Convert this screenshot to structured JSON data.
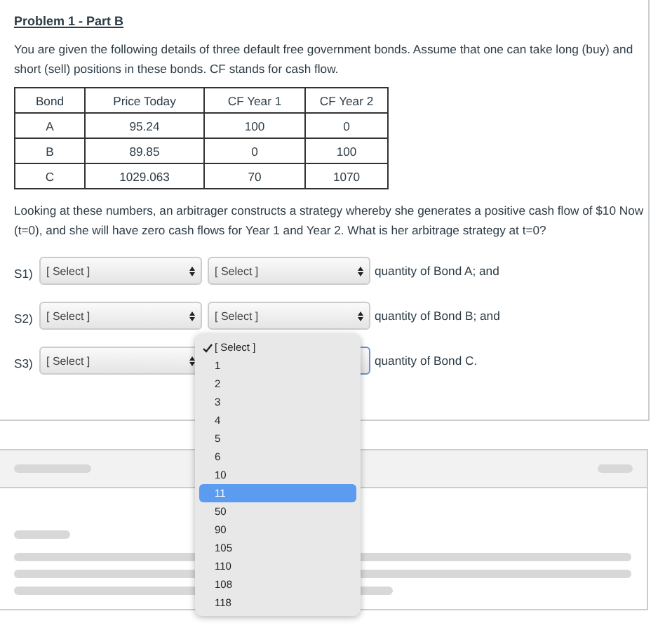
{
  "title": "Problem 1 - Part B",
  "intro": "You are given the following details of three default free government bonds. Assume that one can take long (buy) and short (sell) positions in these bonds. CF stands for cash flow.",
  "table": {
    "columns": [
      "Bond",
      "Price Today",
      "CF Year 1",
      "CF Year 2"
    ],
    "rows": [
      [
        "A",
        "95.24",
        "100",
        "0"
      ],
      [
        "B",
        "89.85",
        "0",
        "100"
      ],
      [
        "C",
        "1029.063",
        "70",
        "1070"
      ]
    ]
  },
  "question": "Looking at these numbers, an arbitrager constructs a strategy whereby she generates a positive cash flow of $10 Now (t=0), and she will have zero cash flows for Year 1 and Year 2. What is her arbitrage strategy at t=0?",
  "statements": [
    {
      "label": "S1)",
      "select_1": "[ Select ]",
      "select_2": "[ Select ]",
      "suffix": "quantity of Bond A; and",
      "open": false
    },
    {
      "label": "S2)",
      "select_1": "[ Select ]",
      "select_2": "[ Select ]",
      "suffix": "quantity of Bond B; and",
      "open": false
    },
    {
      "label": "S3)",
      "select_1": "[ Select ]",
      "suffix": "quantity of Bond C.",
      "open": true
    }
  ],
  "dropdown": {
    "options": [
      {
        "label": "[ Select ]",
        "checked": true,
        "selected": false
      },
      {
        "label": "1",
        "checked": false,
        "selected": false
      },
      {
        "label": "2",
        "checked": false,
        "selected": false
      },
      {
        "label": "3",
        "checked": false,
        "selected": false
      },
      {
        "label": "4",
        "checked": false,
        "selected": false
      },
      {
        "label": "5",
        "checked": false,
        "selected": false
      },
      {
        "label": "6",
        "checked": false,
        "selected": false
      },
      {
        "label": "10",
        "checked": false,
        "selected": false
      },
      {
        "label": "11",
        "checked": false,
        "selected": true
      },
      {
        "label": "50",
        "checked": false,
        "selected": false
      },
      {
        "label": "90",
        "checked": false,
        "selected": false
      },
      {
        "label": "105",
        "checked": false,
        "selected": false
      },
      {
        "label": "110",
        "checked": false,
        "selected": false
      },
      {
        "label": "108",
        "checked": false,
        "selected": false
      },
      {
        "label": "118",
        "checked": false,
        "selected": false
      }
    ]
  }
}
